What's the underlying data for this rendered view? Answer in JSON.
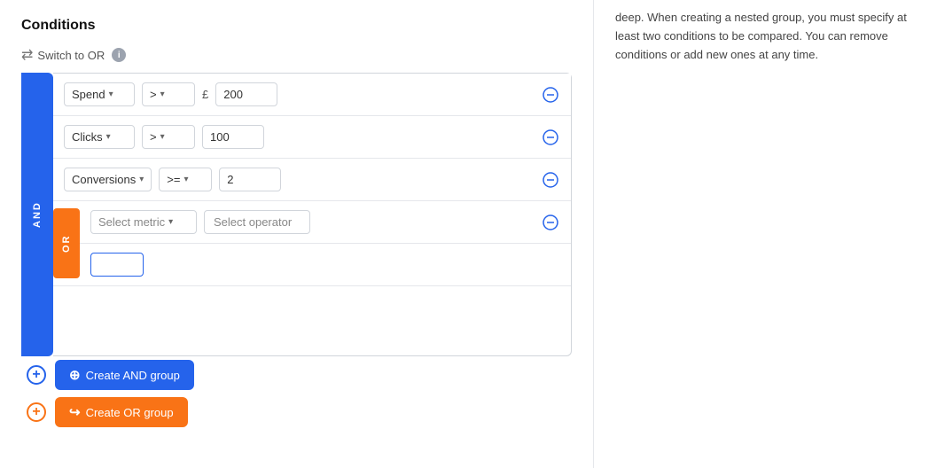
{
  "title": "Conditions",
  "switch_or": {
    "label": "Switch to OR",
    "icon": "switch-icon"
  },
  "info_icon": "i",
  "and_label": "AND",
  "or_label": "OR",
  "rows": [
    {
      "metric": "Spend",
      "operator": ">",
      "currency": "£",
      "value": "200"
    },
    {
      "metric": "Clicks",
      "operator": ">",
      "currency": null,
      "value": "100"
    },
    {
      "metric": "Conversions",
      "operator": ">=",
      "currency": null,
      "value": "2"
    }
  ],
  "or_row": {
    "select_metric_placeholder": "Select metric",
    "select_operator_placeholder": "Select operator",
    "value": ""
  },
  "buttons": {
    "create_and": "Create AND group",
    "create_or": "Create OR group"
  },
  "right_panel_text": "deep. When creating a nested group, you must specify at least two conditions to be compared. You can remove conditions or add new ones at any time."
}
